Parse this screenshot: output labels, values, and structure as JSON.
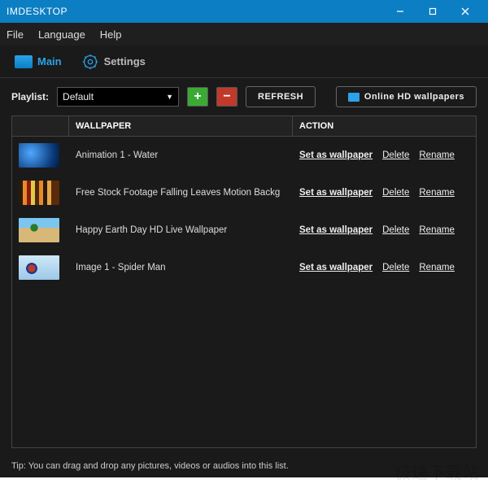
{
  "title": "IMDESKTOP",
  "menu": {
    "file": "File",
    "language": "Language",
    "help": "Help"
  },
  "tabs": {
    "main": "Main",
    "settings": "Settings"
  },
  "toolbar": {
    "playlist_label": "Playlist:",
    "playlist_value": "Default",
    "refresh": "REFRESH",
    "online": "Online HD wallpapers"
  },
  "table": {
    "headers": {
      "wallpaper": "WALLPAPER",
      "action": "ACTION"
    },
    "rows": [
      {
        "name": "Animation 1 - Water"
      },
      {
        "name": "Free Stock Footage Falling Leaves Motion Backg"
      },
      {
        "name": "Happy Earth Day HD Live Wallpaper"
      },
      {
        "name": "Image 1 - Spider Man"
      }
    ],
    "actions": {
      "set": "Set as wallpaper",
      "delete": "Delete",
      "rename": "Rename"
    }
  },
  "tip": "Tip: You can drag and drop any pictures, videos or audios into this list.",
  "watermark": "极速下载站"
}
